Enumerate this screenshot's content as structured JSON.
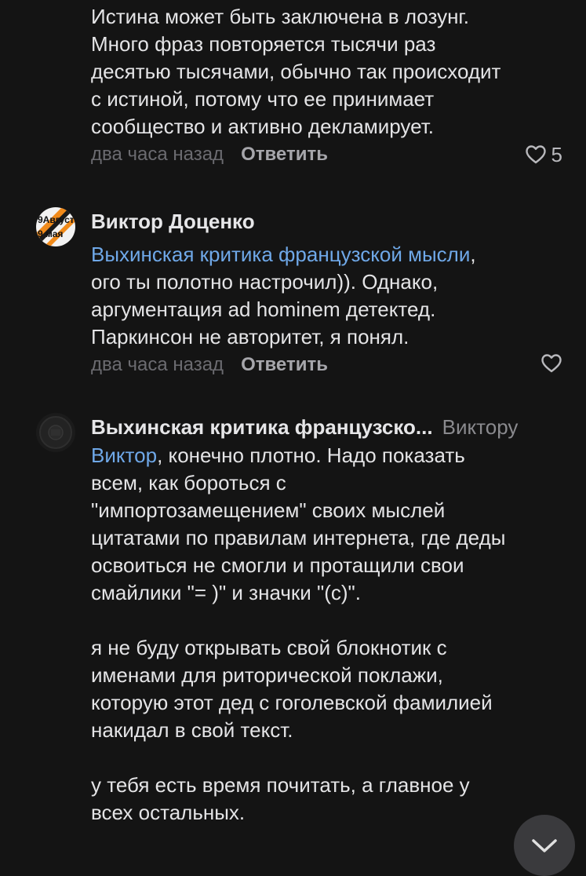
{
  "comments": [
    {
      "text": "Истина может быть заключена в лозунг.\nМного фраз повторяется тысячи раз\nдесятью тысячами, обычно так происходит\nс истиной, потому что ее принимает\nсообщество и активно декламирует.",
      "time": "два часа назад",
      "reply_label": "Ответить",
      "likes": "5"
    },
    {
      "author": "Виктор Доценко",
      "avatar_text_1": "9Августа",
      "avatar_text_2": "9 мая",
      "mention": "Выхинская критика французской мысли",
      "text": ",\nого ты полотно настрочил)). Однако,\nаргументация ad hominem детектед.\nПаркинсон не авторитет, я понял.",
      "time": "два часа назад",
      "reply_label": "Ответить"
    },
    {
      "author": "Выхинская критика французско...",
      "reply_to": "Виктору",
      "mention": "Виктор",
      "text": ", конечно плотно. Надо показать\nвсем, как бороться с\n\"импортозамещением\" своих мыслей\nцитатами по правилам интернета, где деды\nосвоиться не смогли и протащили свои\nсмайлики \"= )\" и значки \"(с)\".\n\nя не буду открывать свой блокнотик с\nименами для риторической поклажи,\nкоторую этот дед с гоголевской фамилией\nнакидал в свой текст.\n\nу тебя есть время почитать, а главное у\nвсех остальных."
    }
  ],
  "colors": {
    "background": "#141414",
    "mention": "#6fa8e8",
    "muted": "#6b6b70"
  },
  "icons": {
    "like": "heart-icon",
    "scroll": "chevron-down-icon"
  }
}
